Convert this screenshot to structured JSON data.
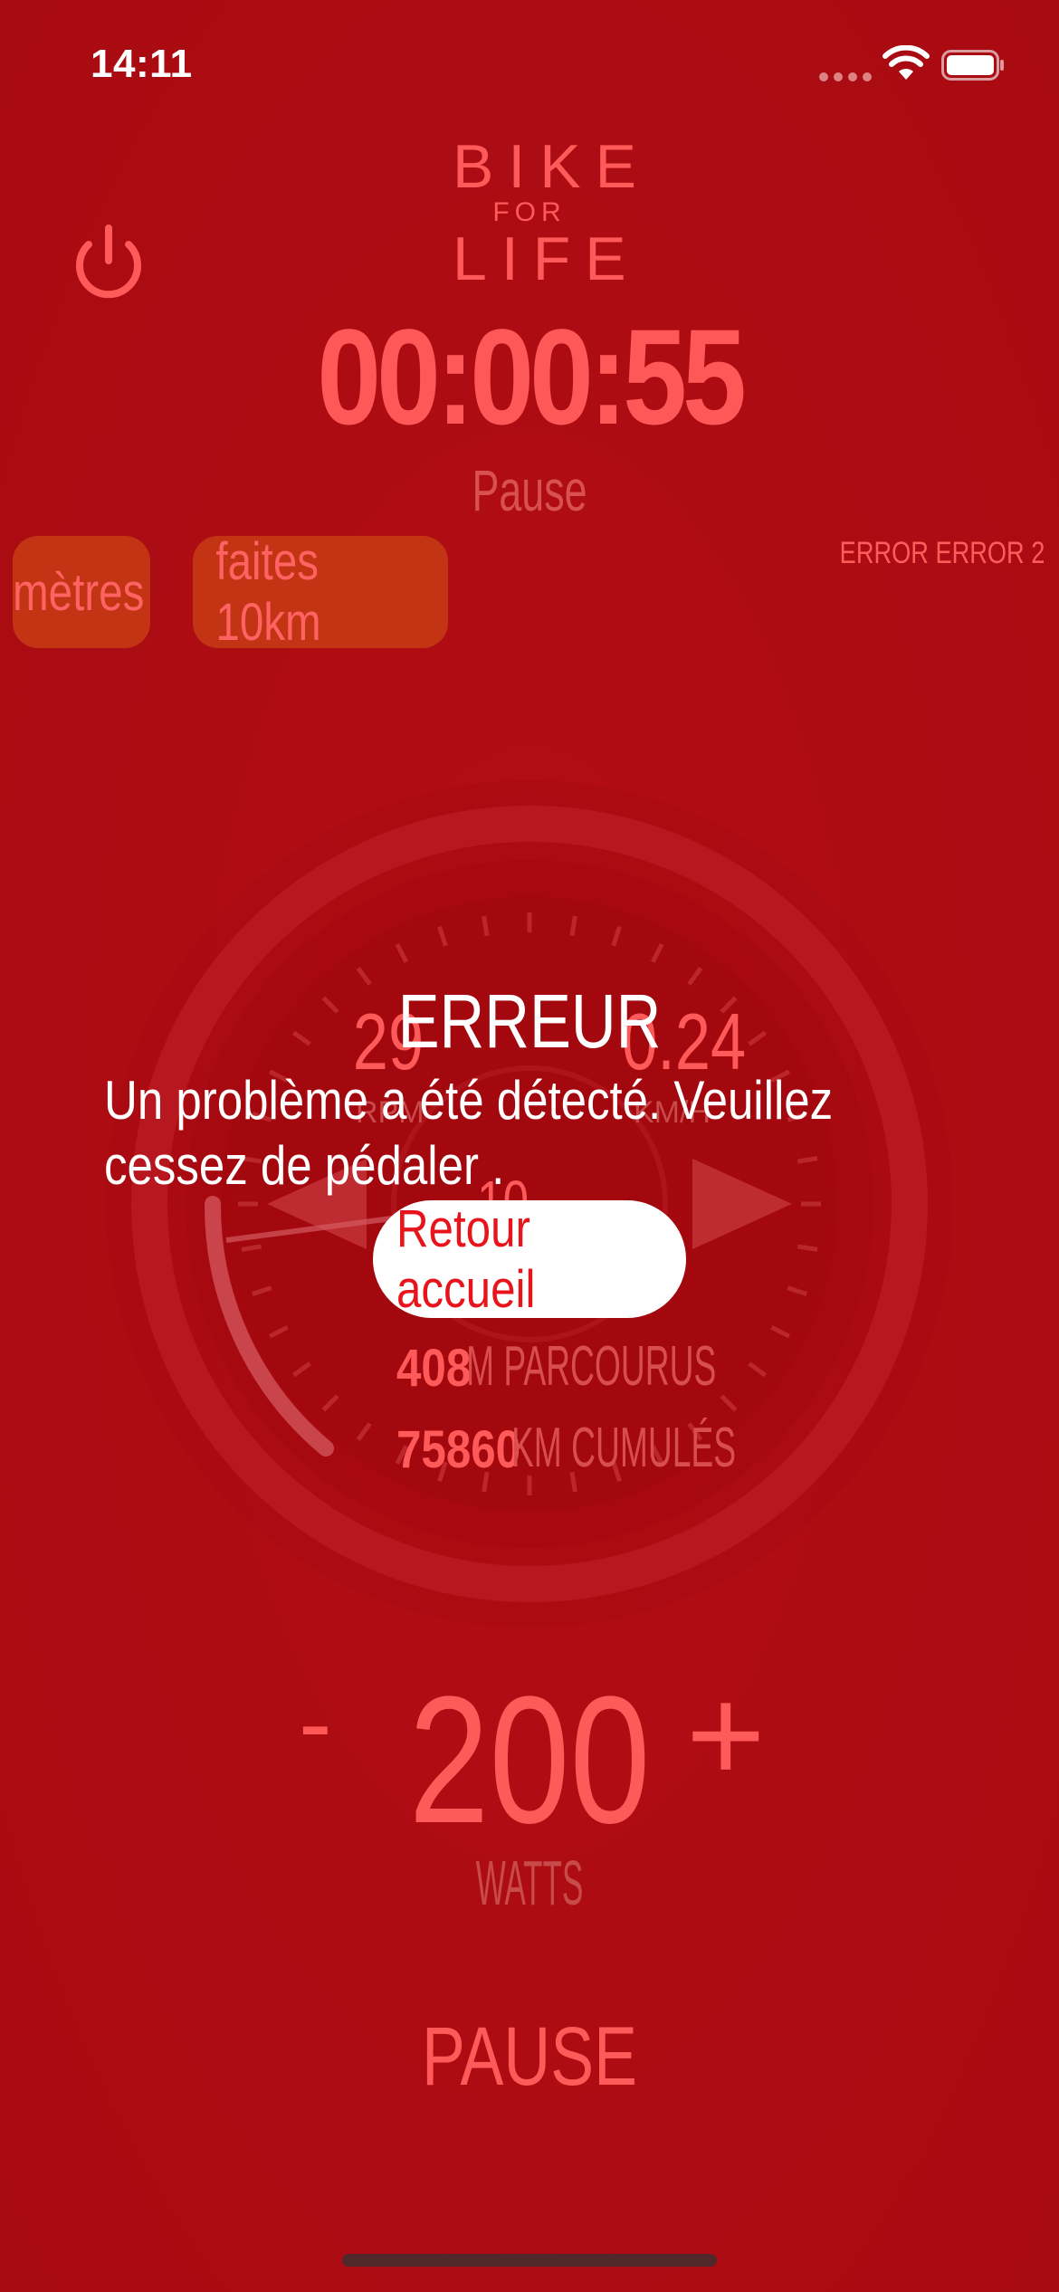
{
  "status_bar": {
    "time": "14:11"
  },
  "logo": {
    "line1": "BIKE",
    "line2": "FOR",
    "line3": "LIFE"
  },
  "session": {
    "timer": "00:00:55",
    "state": "Pause"
  },
  "chips": [
    {
      "label": "mètres"
    },
    {
      "label": "faites 10km"
    }
  ],
  "error_code": "ERROR ERROR 2",
  "gauge": {
    "rpm_value": "29",
    "rpm_label": "RPM",
    "speed_value": "0.24",
    "speed_label": "KM/H",
    "center_value": "10",
    "distance_value": "408",
    "distance_unit": "M PARCOURUS",
    "cumulative_value": "75860",
    "cumulative_unit": "KM CUMULÉS"
  },
  "dialog": {
    "title": "ERREUR",
    "message": "Un problème a été détecté. Veuillez cessez de pédaler .",
    "button": "Retour accueil"
  },
  "power": {
    "minus": "-",
    "value": "200",
    "plus": "+",
    "unit": "WATTS"
  },
  "pause_label": "PAUSE",
  "colors": {
    "background": "#ad0c13",
    "accent": "#ff5a5a",
    "chip": "#c23413",
    "button_text": "#e8141c"
  }
}
